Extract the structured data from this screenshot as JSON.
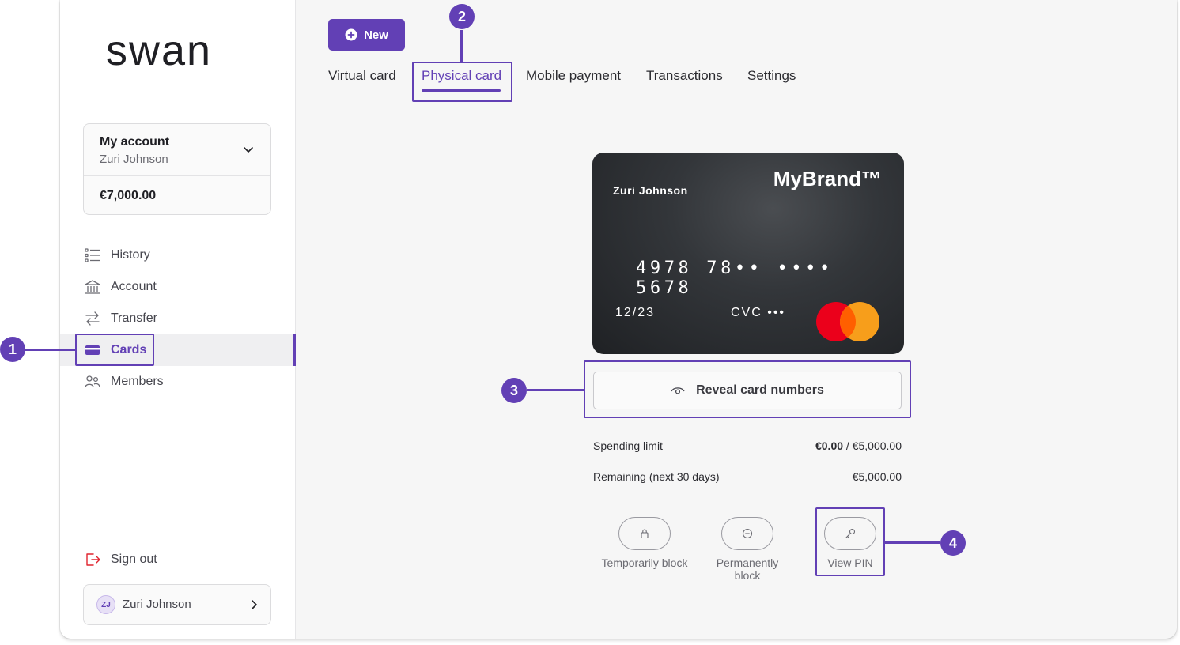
{
  "brand": {
    "logo_text": "swan",
    "accent": "#6240b5"
  },
  "account": {
    "title": "My account",
    "holder": "Zuri Johnson",
    "balance": "€7,000.00"
  },
  "nav": {
    "items": [
      {
        "label": "History",
        "icon": "history-list-icon"
      },
      {
        "label": "Account",
        "icon": "bank-icon"
      },
      {
        "label": "Transfer",
        "icon": "transfer-arrows-icon"
      },
      {
        "label": "Cards",
        "icon": "card-icon",
        "active": true
      },
      {
        "label": "Members",
        "icon": "members-icon"
      }
    ],
    "sign_out": "Sign out"
  },
  "user": {
    "initials": "ZJ",
    "name": "Zuri Johnson"
  },
  "toolbar": {
    "new_label": "New"
  },
  "tabs": [
    "Virtual card",
    "Physical card",
    "Mobile payment",
    "Transactions",
    "Settings"
  ],
  "active_tab": "Physical card",
  "card": {
    "holder": "Zuri Johnson",
    "brand": "MyBrand™",
    "number": "4978 78•• •••• 5678",
    "expiry": "12/23",
    "cvc": "CVC •••",
    "network": "mastercard-logo"
  },
  "reveal_label": "Reveal card numbers",
  "limits": {
    "spending_label": "Spending limit",
    "spending_used": "€0.00",
    "spending_sep": " / ",
    "spending_max": "€5,000.00",
    "remaining_label": "Remaining (next 30 days)",
    "remaining_value": "€5,000.00"
  },
  "actions": [
    {
      "label": "Temporarily block",
      "icon": "lock-icon"
    },
    {
      "label": "Permanently block",
      "icon": "block-icon"
    },
    {
      "label": "View PIN",
      "icon": "key-icon"
    }
  ],
  "annotations": [
    "1",
    "2",
    "3",
    "4"
  ]
}
